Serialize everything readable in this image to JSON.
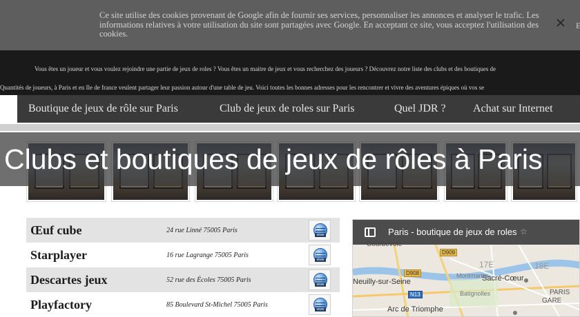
{
  "cookie": {
    "text": "Ce site utilise des cookies provenant de Google afin de fournir ses services, personnaliser les annonces et analyser le trafic. Les informations relatives à votre utilisation du site sont partagées avec Google. En acceptant ce site, vous acceptez l'utilisation des cookies.",
    "extra": "En",
    "close_icon": "close-icon"
  },
  "intro": {
    "line1": "Vous êtes un joueur et vous voulez rejoindre une partie de jeux de roles ? Vous êtes un maitre de jeux et vous recherchez des joueurs ? Découvrez notre liste des clubs et des boutiques de",
    "line2": "Quantités de joueurs, à Paris et en Ile de france veulent partager leur passion autour d'une table de jeu. Voici toutes les bonnes adresses pour les rencontrer et vivre des aventures épiques où vos se"
  },
  "nav": {
    "items": [
      "Boutique de jeux de rôle sur Paris",
      "Club de jeux de roles sur Paris",
      "Quel JDR ?",
      "Achat sur Internet"
    ]
  },
  "hero": {
    "title": "Clubs et boutiques de jeux de rôles à Paris"
  },
  "shops": [
    {
      "name": "Œuf cube",
      "address": "24 rue Linné 75005 Paris",
      "web_label": "www",
      "web_icon": "globe-icon"
    },
    {
      "name": "Starplayer",
      "address": "16 rue Lagrange 75005 Paris",
      "web_label": "www",
      "web_icon": "globe-icon"
    },
    {
      "name": "Descartes jeux",
      "address": "52 rue des Écoles 75005 Paris",
      "web_label": "www",
      "web_icon": "globe-icon"
    },
    {
      "name": "Playfactory",
      "address": "85 Boulevard St-Michel 75005 Paris",
      "web_label": "www",
      "web_icon": "globe-icon"
    }
  ],
  "map": {
    "title": "Paris - boutique de jeux de roles",
    "star": "☆",
    "labels": {
      "courbevoie": "Courbevoie",
      "neuilly": "Neuilly-sur-Seine",
      "arc": "Arc de Triomphe",
      "e17": "17E",
      "e18": "18E",
      "sacre": "Sacré-Cœur",
      "paris": "PARIS",
      "gare": "GARE",
      "batignolles": "Batignolles",
      "montmartre": "Montmartre"
    },
    "roads": [
      "D909",
      "D908",
      "N13"
    ]
  },
  "colors": {
    "cookie_bg": "#5e5e5e",
    "nav_bg": "#3a3a3a",
    "alt_row": "#e3e3e3",
    "map_header": "#4c4c4c"
  }
}
